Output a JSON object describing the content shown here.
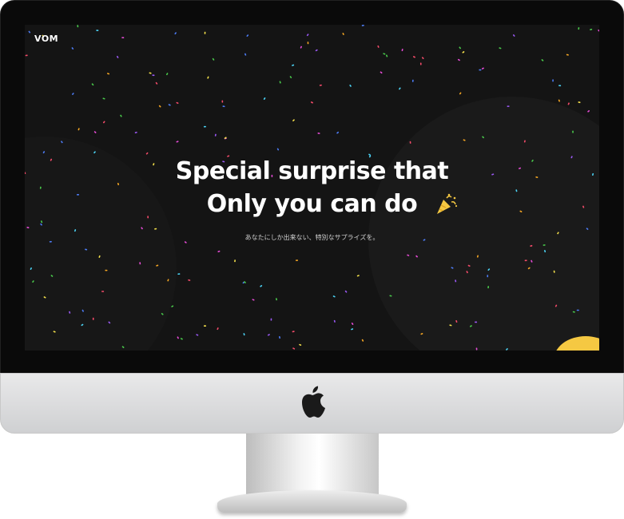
{
  "brand": {
    "logo_text": "VOM"
  },
  "hero": {
    "headline_line1": "Special surprise that",
    "headline_line2": "Only you can do",
    "headline_icon": "party-popper-icon",
    "subtext": "あなたにしか出来ない、特別なサプライズを。"
  },
  "device": {
    "type": "desktop-monitor",
    "chin_icon": "apple-logo-icon"
  },
  "colors": {
    "screen_background": "#141414",
    "text": "#ffffff",
    "subtext": "#d0d0d0",
    "accent_yellow": "#f5c842",
    "confetti": [
      "#e64bd6",
      "#4d7cf5",
      "#f5a623",
      "#49c94b",
      "#9b59f5",
      "#f54b6a",
      "#4bd3f5",
      "#f5e14b"
    ]
  }
}
